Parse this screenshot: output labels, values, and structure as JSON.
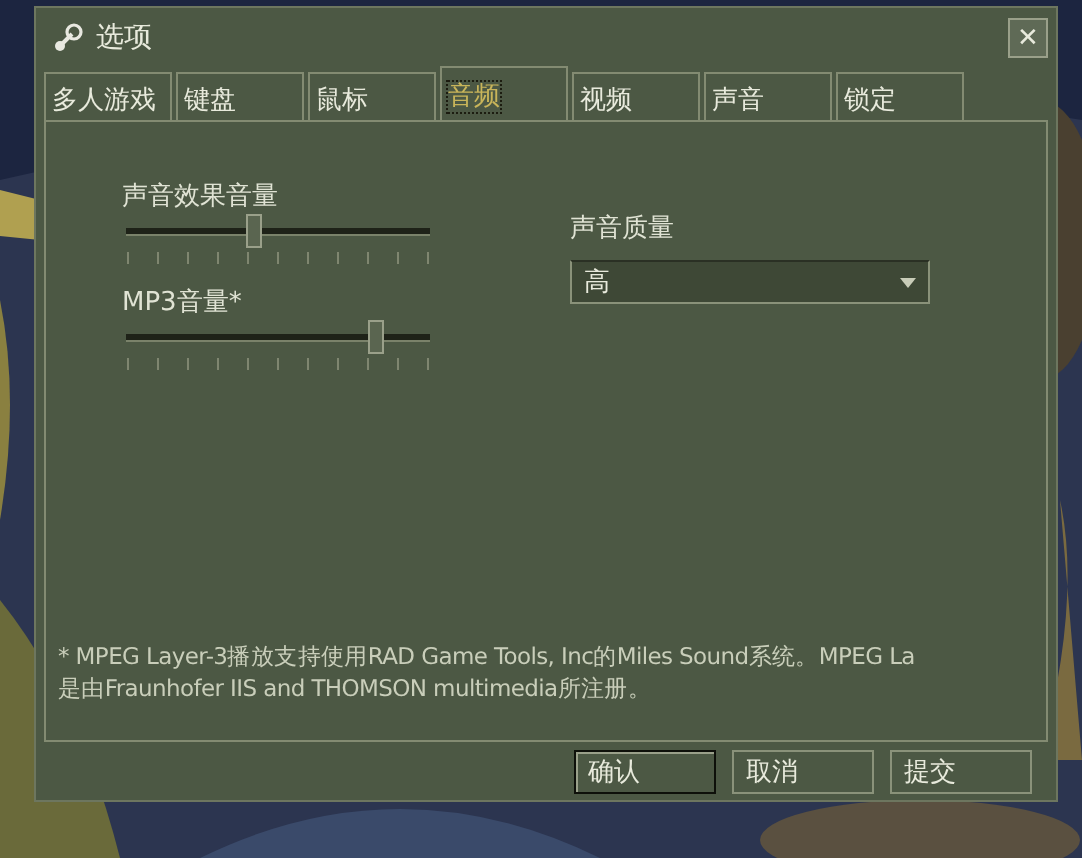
{
  "window": {
    "title": "选项",
    "close": "✕"
  },
  "tabs": [
    {
      "label": "多人游戏",
      "selected": false
    },
    {
      "label": "键盘",
      "selected": false
    },
    {
      "label": "鼠标",
      "selected": false
    },
    {
      "label": "音频",
      "selected": true
    },
    {
      "label": "视频",
      "selected": false
    },
    {
      "label": "声音",
      "selected": false
    },
    {
      "label": "锁定",
      "selected": false
    }
  ],
  "sliders": [
    {
      "label": "声音效果音量",
      "level": 0.42
    },
    {
      "label": "MP3音量*",
      "level": 0.82
    }
  ],
  "quality": {
    "label": "声音质量",
    "value": "高"
  },
  "footnote": "* MPEG Layer-3播放支持使用RAD Game Tools, Inc的Miles Sound系统。MPEG La\n是由Fraunhofer IIS and THOMSON multimedia所注册。",
  "buttons": [
    {
      "label": "确认",
      "selected": true
    },
    {
      "label": "取消",
      "selected": false
    },
    {
      "label": "提交",
      "selected": false
    }
  ]
}
